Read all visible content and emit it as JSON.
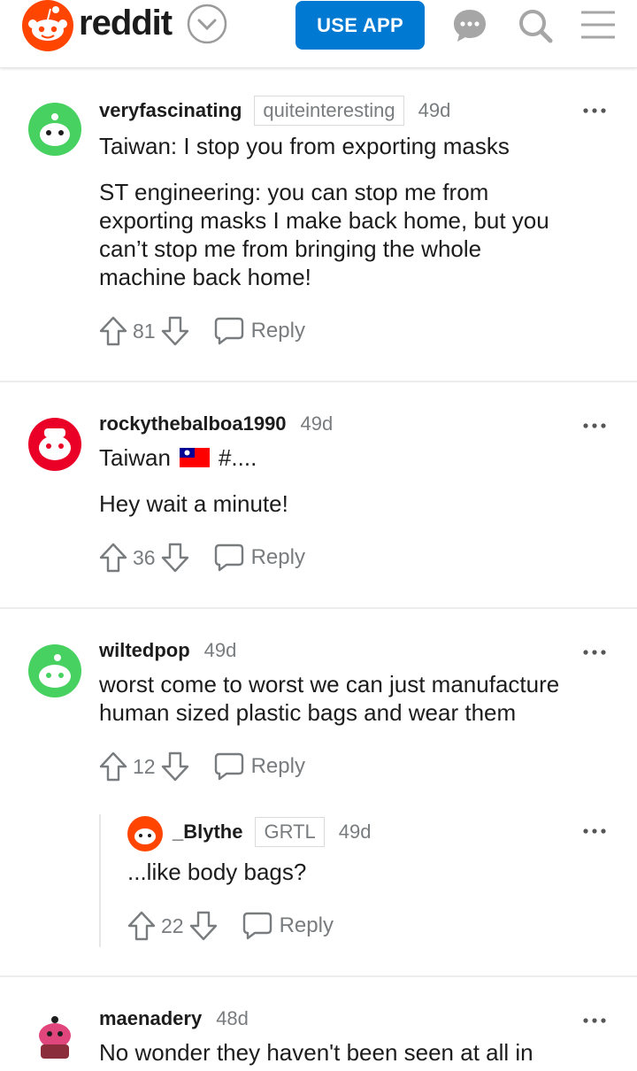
{
  "header": {
    "wordmark": "reddit",
    "use_app_label": "USE APP",
    "icons": [
      "reddit-logo-icon",
      "chevron-down-icon",
      "chat-icon",
      "search-icon",
      "menu-icon"
    ]
  },
  "comments": [
    {
      "username": "veryfascinating",
      "flair": "quiteinteresting",
      "age": "49d",
      "lines": [
        "Taiwan: I stop you from exporting masks"
      ],
      "paragraph2": [
        "ST engineering: you can stop me from",
        "exporting masks I make back home, but you",
        "can’t stop me from bringing the whole",
        "machine back home!"
      ],
      "votes": "81",
      "reply_label": "Reply",
      "avatar_color": "#46d160"
    },
    {
      "username": "rockythebalboa1990",
      "age": "49d",
      "line1": "Taiwan",
      "line1_tail": "#....",
      "line2": "Hey wait a minute!",
      "votes": "36",
      "reply_label": "Reply",
      "avatar_color": "#ea0027"
    },
    {
      "username": "wiltedpop",
      "age": "49d",
      "lines": [
        "worst come to worst we can just manufacture",
        "human sized plastic bags and wear them"
      ],
      "votes": "12",
      "reply_label": "Reply",
      "avatar_color": "#46d160"
    },
    {
      "username": "_Blythe",
      "flair": "GRTL",
      "age": "49d",
      "lines": [
        "...like body bags?"
      ],
      "votes": "22",
      "reply_label": "Reply",
      "avatar_color": "#ff4500"
    },
    {
      "username": "maenadery",
      "age": "48d",
      "lines": [
        "No wonder they haven't been seen at all in"
      ],
      "avatar_color": "#ffffff"
    }
  ],
  "colors": {
    "brand": "#ff4500",
    "button": "#0079d3",
    "muted": "#787c7e"
  }
}
